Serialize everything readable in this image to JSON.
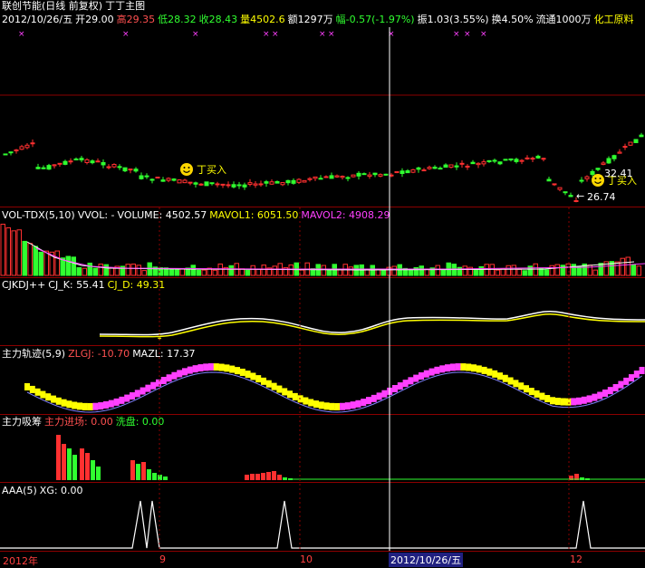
{
  "header": {
    "stock_title": "联创节能(日线 前复权)",
    "indicator": "丁丁主图",
    "date": "2012/10/26/五",
    "open": "开29.00",
    "high": "高29.35",
    "low": "低28.32",
    "close": "收28.43",
    "volume": "量4502.6",
    "amount": "额1297万",
    "change": "幅-0.57(-1.97%)",
    "amplitude": "振1.03(3.55%)",
    "turnover": "换4.50%",
    "float": "流通1000万",
    "industry": "化工原料"
  },
  "main_chart": {
    "buy_label": "丁买入",
    "price_high": "32.41",
    "price_low": "26.74",
    "arrow": "←"
  },
  "vol_panel": {
    "title": "VOL-TDX(5,10)",
    "vvol": "VVOL: -",
    "volume": "VOLUME: 4502.57",
    "mavol1": "MAVOL1: 6051.50",
    "mavol2": "MAVOL2: 4908.29"
  },
  "kdj_panel": {
    "title": "CJKDJ++",
    "k": "CJ_K: 55.41",
    "d": "CJ_D: 49.31"
  },
  "zlgj_panel": {
    "title": "主力轨迹(5,9)",
    "zlgj": "ZLGJ: -10.70",
    "mazl": "MAZL: 17.37"
  },
  "zlxc_panel": {
    "title": "主力吸筹",
    "in": "主力进场: 0.00",
    "wash": "洗盘: 0.00"
  },
  "aaa_panel": {
    "title": "AAA(5)",
    "xg": "XG: 0.00"
  },
  "time_axis": {
    "year": "2012年",
    "m9": "9",
    "m10": "10",
    "selected": "2012/10/26/五",
    "m12": "12"
  },
  "colors": {
    "up": "#ff3030",
    "down": "#30ff30",
    "separator": "#8b0000",
    "accent": "#ffff00",
    "magenta": "#ff40ff"
  }
}
